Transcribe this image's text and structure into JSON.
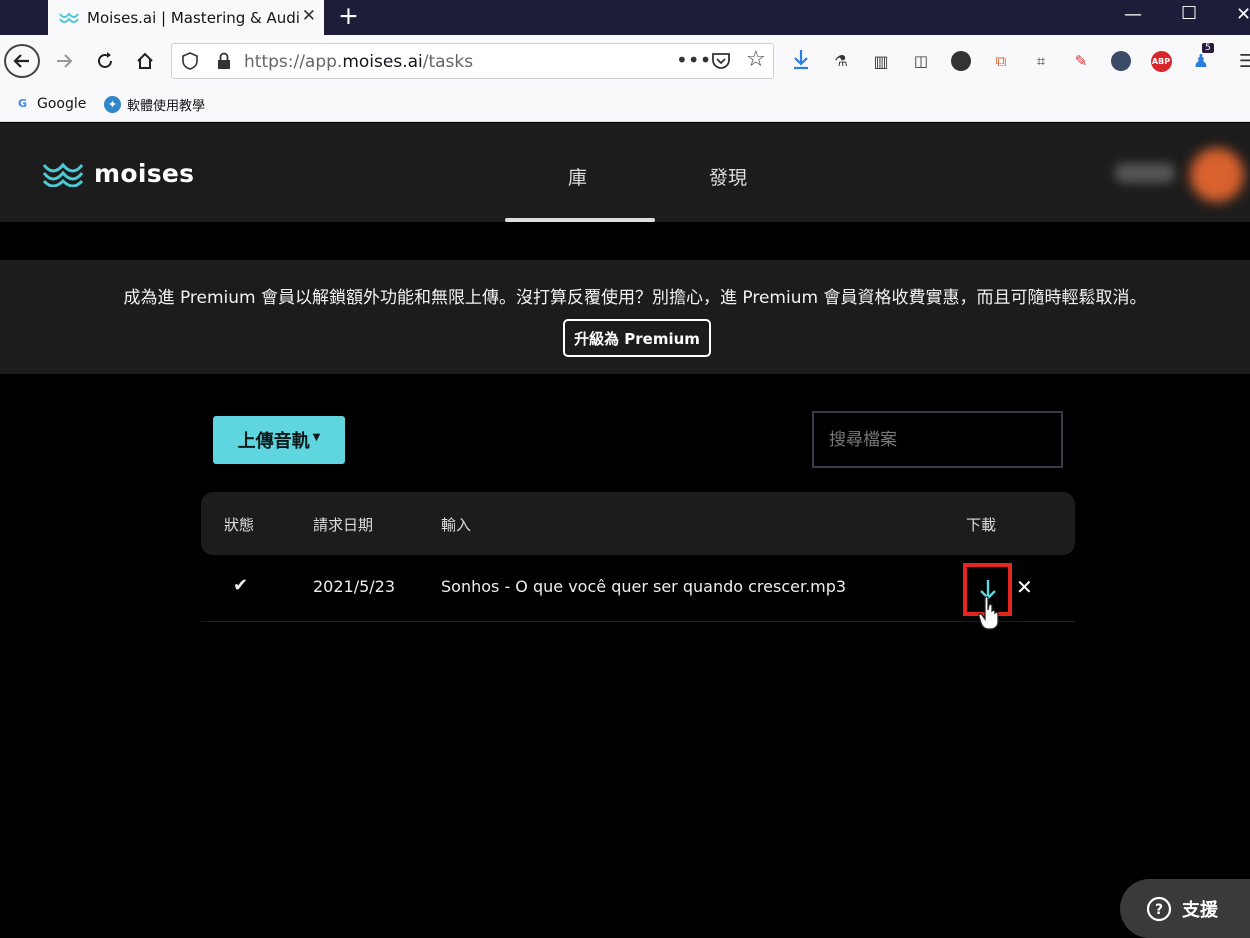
{
  "browser": {
    "tab_title": "Moises.ai | Mastering & Audio",
    "url_prefix": "https://app.",
    "url_domain": "moises.ai",
    "url_path": "/tasks",
    "bookmarks": [
      {
        "label": "Google"
      },
      {
        "label": "軟體使用教學"
      }
    ],
    "notification_badge": "5",
    "ext_abp_label": "ABP"
  },
  "app": {
    "logo_text": "moises",
    "nav_tabs": [
      {
        "label": "庫",
        "active": true
      },
      {
        "label": "發現",
        "active": false
      }
    ],
    "accent_color": "#5fd6df"
  },
  "banner": {
    "text": "成為進 Premium 會員以解鎖額外功能和無限上傳。沒打算反覆使用？別擔心，進 Premium 會員資格收費實惠，而且可隨時輕鬆取消。",
    "upgrade_label": "升級為 Premium"
  },
  "toolbar": {
    "upload_label": "上傳音軌",
    "search_placeholder": "搜尋檔案"
  },
  "table": {
    "columns": [
      "狀態",
      "請求日期",
      "輸入",
      "下載"
    ],
    "rows": [
      {
        "status": "✔",
        "date": "2021/5/23",
        "input": "Sonhos - O que você quer ser quando crescer.mp3",
        "delete": "✕"
      }
    ]
  },
  "support": {
    "label": "支援"
  }
}
